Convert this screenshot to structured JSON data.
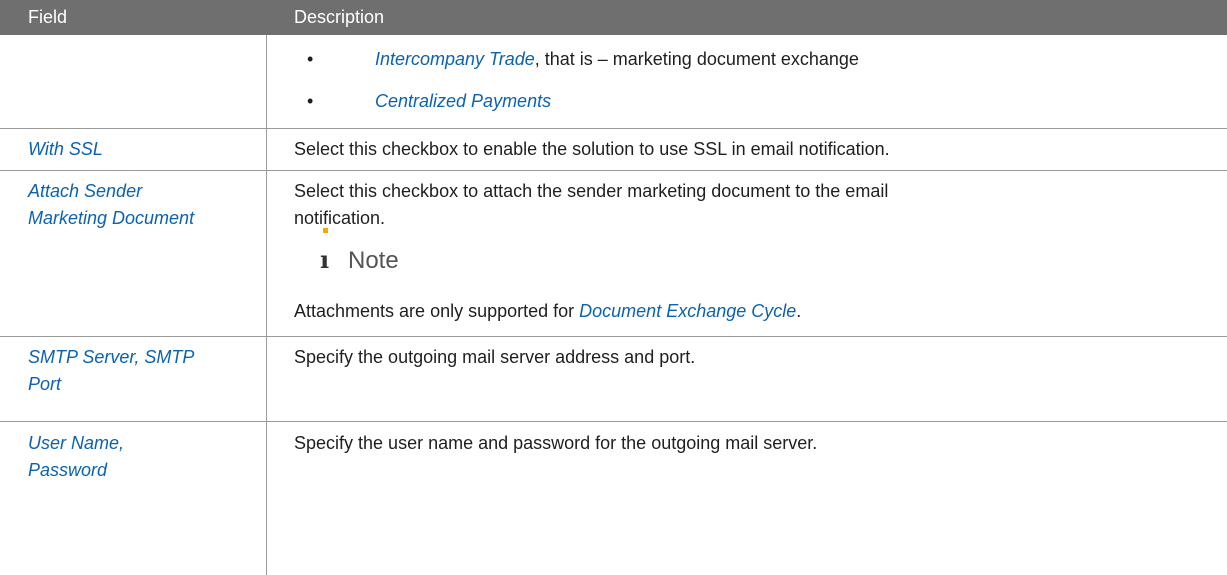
{
  "header": {
    "field": "Field",
    "description": "Description"
  },
  "bullets": [
    {
      "link": "Intercompany Trade",
      "text": ", that is – marketing document exchange"
    },
    {
      "link": "Centralized Payments",
      "text": ""
    }
  ],
  "rows": [
    {
      "field": "With SSL",
      "description": "Select this checkbox to enable the solution to use SSL in email notification."
    },
    {
      "field_line1": "Attach Sender",
      "field_line2": "Marketing Document",
      "description_line1": "Select this checkbox to attach the sender marketing document to the email",
      "description_line2": "notification.",
      "note_label": "Note",
      "note_text_before": "Attachments are only supported for ",
      "note_link": "Document Exchange Cycle",
      "note_text_after": "."
    },
    {
      "field_line1": "SMTP Server, SMTP",
      "field_line2": "Port",
      "description": "Specify the outgoing mail server address and port."
    },
    {
      "field_line1": "User Name,",
      "field_line2": "Password",
      "description": "Specify the user name and password for the outgoing mail server."
    }
  ],
  "colors": {
    "header_bg": "#6f6f6f",
    "link": "#0b62b0",
    "note_accent": "#f0ab00"
  },
  "icons": {
    "note": "info-i-icon"
  }
}
